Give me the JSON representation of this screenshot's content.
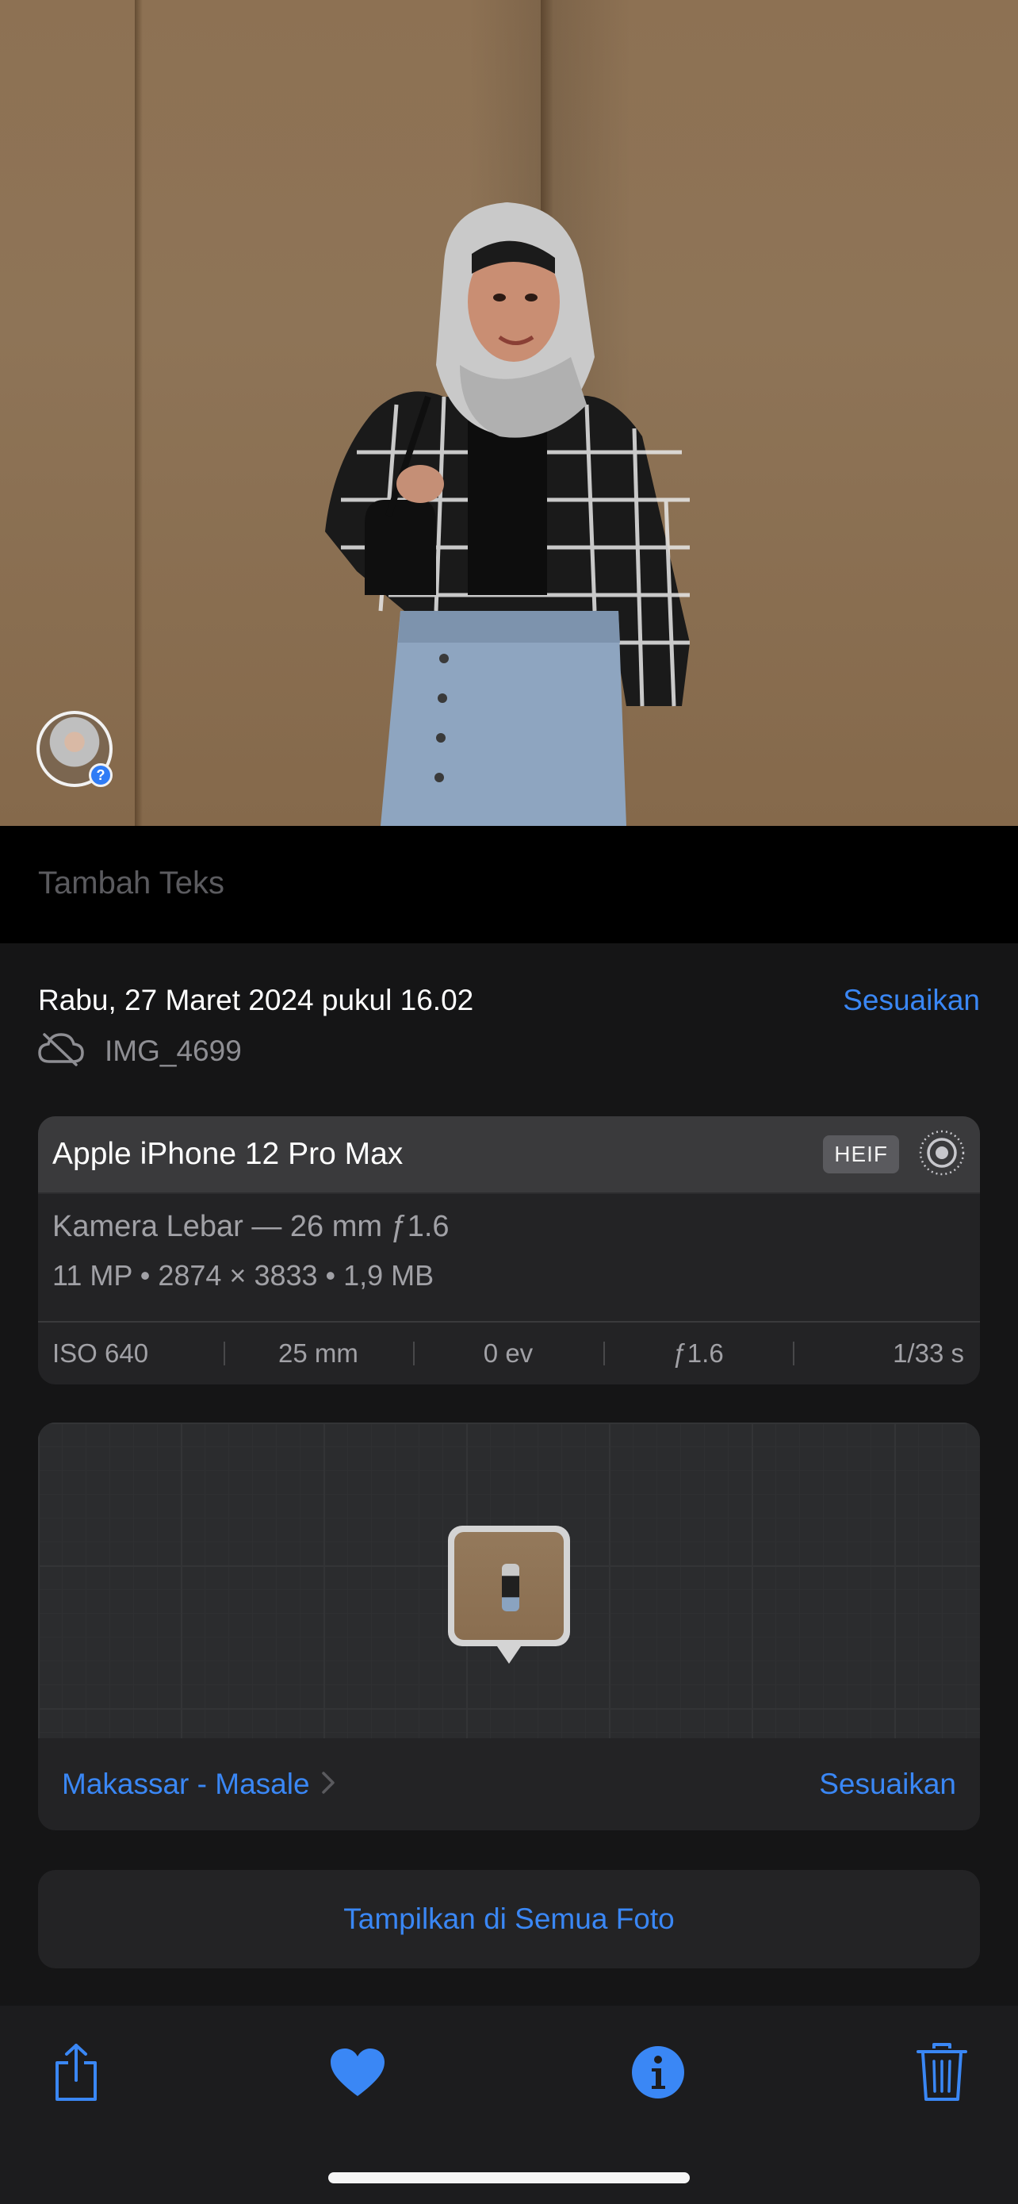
{
  "caption": {
    "placeholder": "Tambah Teks"
  },
  "info": {
    "datetime": "Rabu, 27 Maret 2024 pukul 16.02",
    "adjust_label": "Sesuaikan",
    "filename": "IMG_4699"
  },
  "camera": {
    "model": "Apple iPhone 12 Pro Max",
    "format_badge": "HEIF",
    "lens": "Kamera Lebar — 26 mm ƒ1.6",
    "meta": "11 MP  •  2874 × 3833  •  1,9 MB",
    "stats": {
      "iso": "ISO 640",
      "focal": "25 mm",
      "ev": "0 ev",
      "aperture": "ƒ1.6",
      "shutter": "1/33 s"
    }
  },
  "location": {
    "place": "Makassar - Masale",
    "adjust_label": "Sesuaikan"
  },
  "show_all_label": "Tampilkan di Semua Foto",
  "toolbar": {
    "icons": [
      "share-icon",
      "favorite-heart-icon",
      "info-icon",
      "trash-icon"
    ]
  },
  "colors": {
    "accent": "#3a87f5",
    "background": "#151516",
    "card": "#232325"
  }
}
